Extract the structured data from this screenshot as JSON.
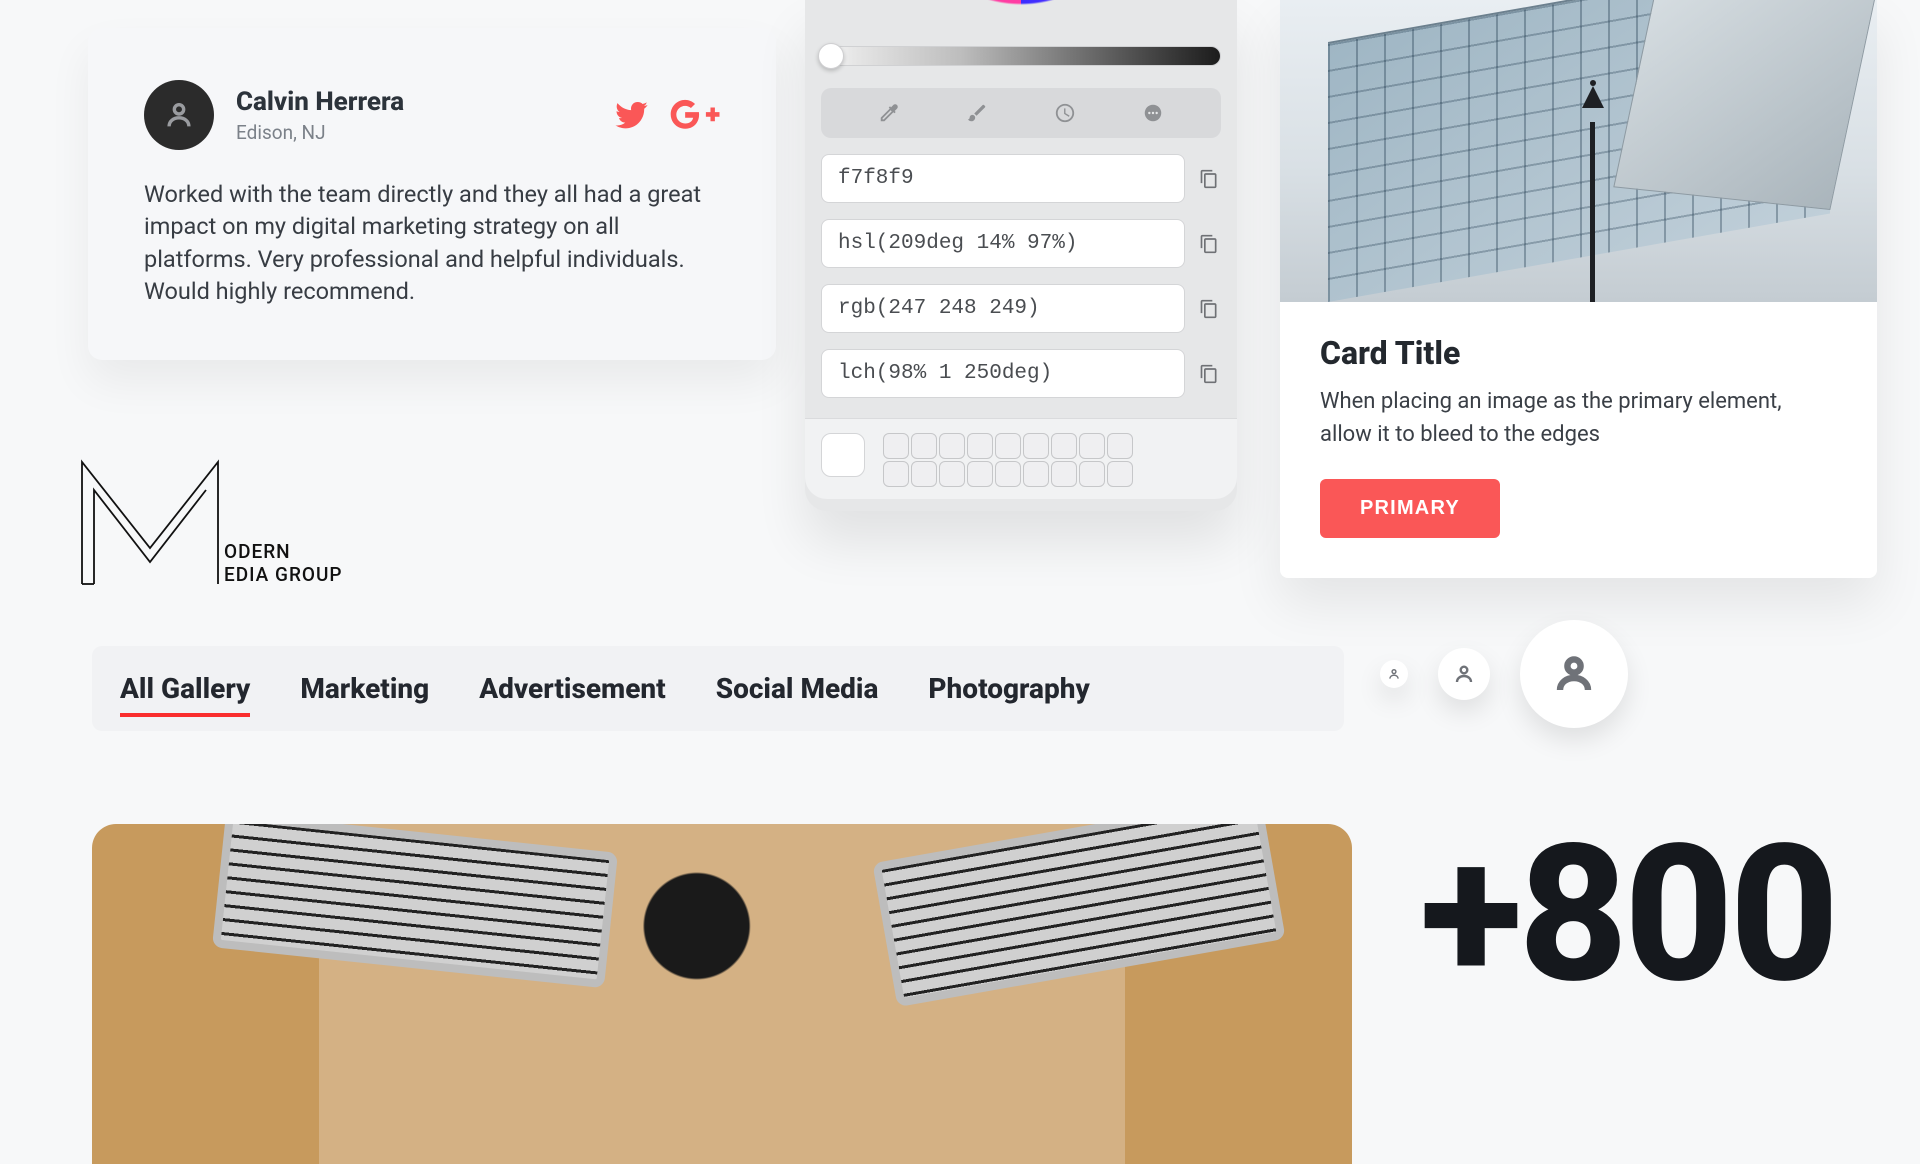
{
  "testimonial": {
    "name": "Calvin Herrera",
    "location": "Edison, NJ",
    "body": "Worked with the team directly and they all had a great impact on my digital marketing strategy on all platforms. Very professional and helpful individuals. Would highly recommend."
  },
  "color_panel": {
    "hex": "f7f8f9",
    "hsl": "hsl(209deg 14% 97%)",
    "rgb": "rgb(247 248 249)",
    "lch": "lch(98% 1 250deg)"
  },
  "image_card": {
    "title": "Card Title",
    "description": "When placing an image as the primary element, allow it to bleed to the edges",
    "button": "PRIMARY"
  },
  "logo": {
    "line1": "ODERN",
    "line2": "EDIA GROUP"
  },
  "tabs": [
    {
      "label": "All Gallery",
      "active": true
    },
    {
      "label": "Marketing",
      "active": false
    },
    {
      "label": "Advertisement",
      "active": false
    },
    {
      "label": "Social Media",
      "active": false
    },
    {
      "label": "Photography",
      "active": false
    }
  ],
  "big_number": "+800"
}
